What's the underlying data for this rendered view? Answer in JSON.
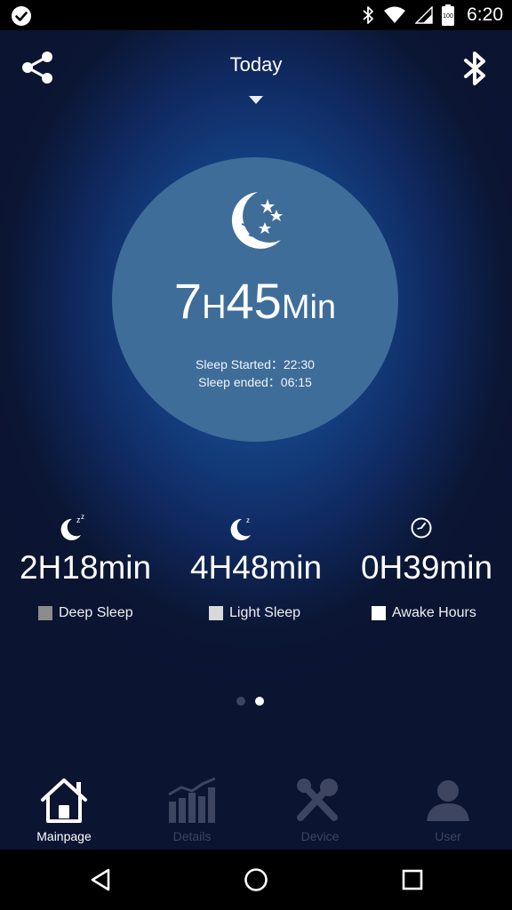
{
  "status_bar": {
    "time": "6:20",
    "battery_level": "100",
    "icons": [
      "check-circle-icon",
      "bluetooth-icon",
      "wifi-icon",
      "signal-icon",
      "battery-icon"
    ]
  },
  "header": {
    "title": "Today",
    "left_icon": "share-icon",
    "right_icon": "bluetooth-icon",
    "dropdown_icon": "dropdown-arrow-icon"
  },
  "summary": {
    "hours": "7",
    "hours_unit": "H",
    "minutes": "45",
    "minutes_unit": "Min",
    "started_label": "Sleep Started：",
    "started_value": "22:30",
    "ended_label": "Sleep ended：",
    "ended_value": "06:15"
  },
  "stats": [
    {
      "value": "2H18min",
      "label": "Deep Sleep",
      "icon": "deep-sleep-moon-icon",
      "swatch_color": "#8c8c8c"
    },
    {
      "value": "4H48min",
      "label": "Light Sleep",
      "icon": "light-sleep-moon-icon",
      "swatch_color": "#d9d9d9"
    },
    {
      "value": "0H39min",
      "label": "Awake Hours",
      "icon": "clock-icon",
      "swatch_color": "#ffffff"
    }
  ],
  "pager": {
    "pages": 2,
    "active_page": 2
  },
  "tabs": [
    {
      "label": "Mainpage",
      "icon": "home-icon",
      "active": true
    },
    {
      "label": "Details",
      "icon": "bar-chart-icon",
      "active": false
    },
    {
      "label": "Device",
      "icon": "tools-icon",
      "active": false
    },
    {
      "label": "User",
      "icon": "user-icon",
      "active": false
    }
  ],
  "nav": {
    "icons": [
      "back-icon",
      "home-circle-icon",
      "recents-icon"
    ]
  },
  "colors": {
    "background": "#0c1230",
    "glow": "#1c63aa",
    "circle": "#3f6d99",
    "tab_active": "#ffffff",
    "tab_inactive": "#3d4560"
  }
}
